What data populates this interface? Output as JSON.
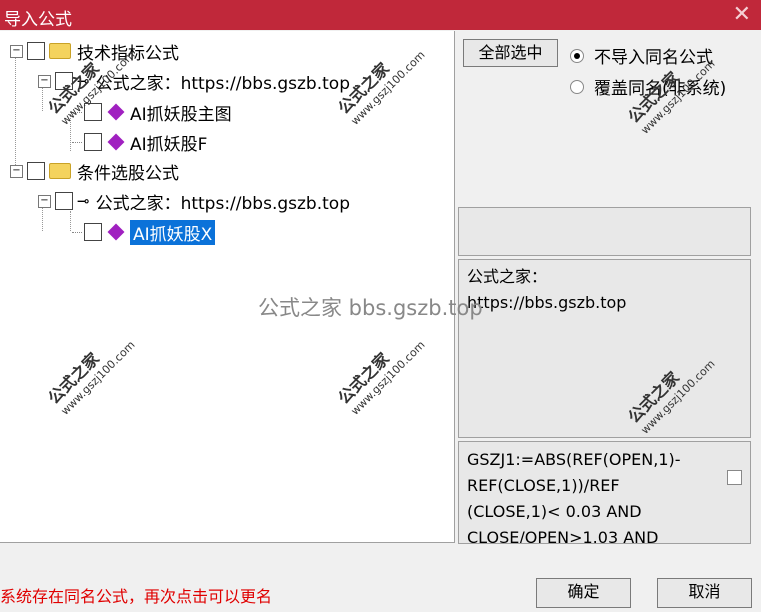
{
  "window": {
    "title": "导入公式"
  },
  "tree": {
    "items": [
      {
        "label": "技术指标公式"
      },
      {
        "label": "公式之家：https://bbs.gszb.top"
      },
      {
        "label": "AI抓妖股主图"
      },
      {
        "label": "AI抓妖股F"
      },
      {
        "label": "条件选股公式"
      },
      {
        "label": "公式之家：https://bbs.gszb.top"
      },
      {
        "label": "AI抓妖股X"
      }
    ]
  },
  "buttons": {
    "select_all": "全部选中",
    "ok": "确定",
    "cancel": "取消"
  },
  "options": {
    "no_import": "不导入同名公式",
    "overwrite": "覆盖同名(非系统)"
  },
  "info": {
    "line1": "公式之家：",
    "line2": "https://bbs.gszb.top"
  },
  "code": [
    "GSZJ1:=ABS(REF(OPEN,1)-",
    "REF(CLOSE,1))/REF",
    "(CLOSE,1)< 0.03 AND",
    "CLOSE/OPEN>1.03 AND"
  ],
  "status": "系统存在同名公式，再次点击可以更名",
  "watermark": {
    "center": "公式之家 bbs.gszb.top",
    "brand": "公式之家",
    "site": "www.gszj100.com"
  },
  "colors": {
    "titlebar": "#c0283a",
    "selection": "#0b72d9",
    "status": "#e00000"
  }
}
